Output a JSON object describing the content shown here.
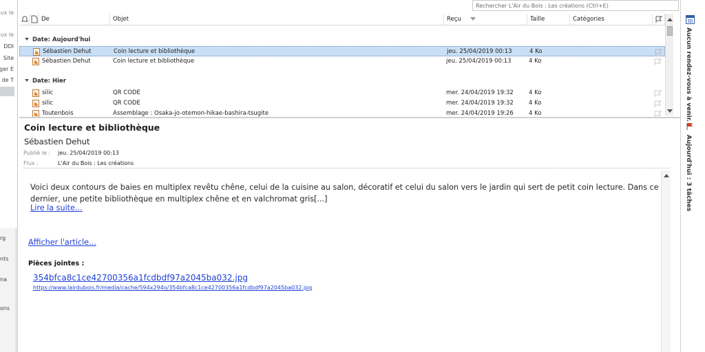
{
  "left_fragments": [
    "ux le",
    "ux le",
    "DDI",
    "Site",
    "ger  E",
    "de T",
    "rg",
    "nts",
    "na",
    "ons"
  ],
  "search": {
    "placeholder": "Rechercher L'Air du Bois : Les créations (Ctrl+E)"
  },
  "columns": {
    "from": "De",
    "subject": "Objet",
    "received": "Reçu",
    "size": "Taille",
    "categories": "Catégories"
  },
  "groups": [
    {
      "label": "Date: Aujourd'hui"
    },
    {
      "label": "Date: Hier"
    }
  ],
  "messages": [
    {
      "from": "Sébastien Dehut",
      "subject": "Coin lecture et bibliothèque",
      "received": "jeu. 25/04/2019 00:13",
      "size": "4 Ko",
      "selected": true
    },
    {
      "from": "Sébastien Dehut",
      "subject": "Coin lecture et bibliothèque",
      "received": "jeu. 25/04/2019 00:13",
      "size": "4 Ko"
    },
    {
      "from": "silic",
      "subject": "QR CODE",
      "received": "mer. 24/04/2019 19:32",
      "size": "4 Ko"
    },
    {
      "from": "silic",
      "subject": "QR CODE",
      "received": "mer. 24/04/2019 19:32",
      "size": "4 Ko"
    },
    {
      "from": "Toutenbois",
      "subject": "Assemblage  : Osaka-jo-otemon-hikae-bashira-tsugite",
      "received": "mer. 24/04/2019 19:26",
      "size": "4 Ko"
    }
  ],
  "reading": {
    "title": "Coin lecture et bibliothèque",
    "author": "Sébastien Dehut",
    "published_label": "Publié le :",
    "published_value": "jeu. 25/04/2019 00:13",
    "feed_label": "Flux :",
    "feed_value": "L'Air du Bois : Les créations",
    "body": "Voici deux contours de baies en multiplex revêtu chêne, celui de la cuisine au salon, décoratif et celui du salon vers le jardin qui sert de petit coin lecture. Dans ce dernier, une petite bibliothèque en multiplex chêne et en valchromat gris[...]",
    "read_more": "Lire la suite...",
    "show_article": "Afficher l'article...",
    "attachments_label": "Pièces jointes :",
    "attachment_file": "354bfca8c1ce42700356a1fcdbdf97a2045ba032.jpg",
    "attachment_url": "https://www.lairdubois.fr/media/cache/594x294o/354bfca8c1ce42700356a1fcdbdf97a2045ba032.jpg"
  },
  "todo": {
    "appointments": "Aucun rendez-vous à venir.",
    "tasks": "Aujourd'hui : 3 tâches"
  },
  "colors": {
    "selection": "#c9dff5",
    "link": "#1f3fd8",
    "rss": "#e8872a",
    "flag": "#d0402b"
  }
}
